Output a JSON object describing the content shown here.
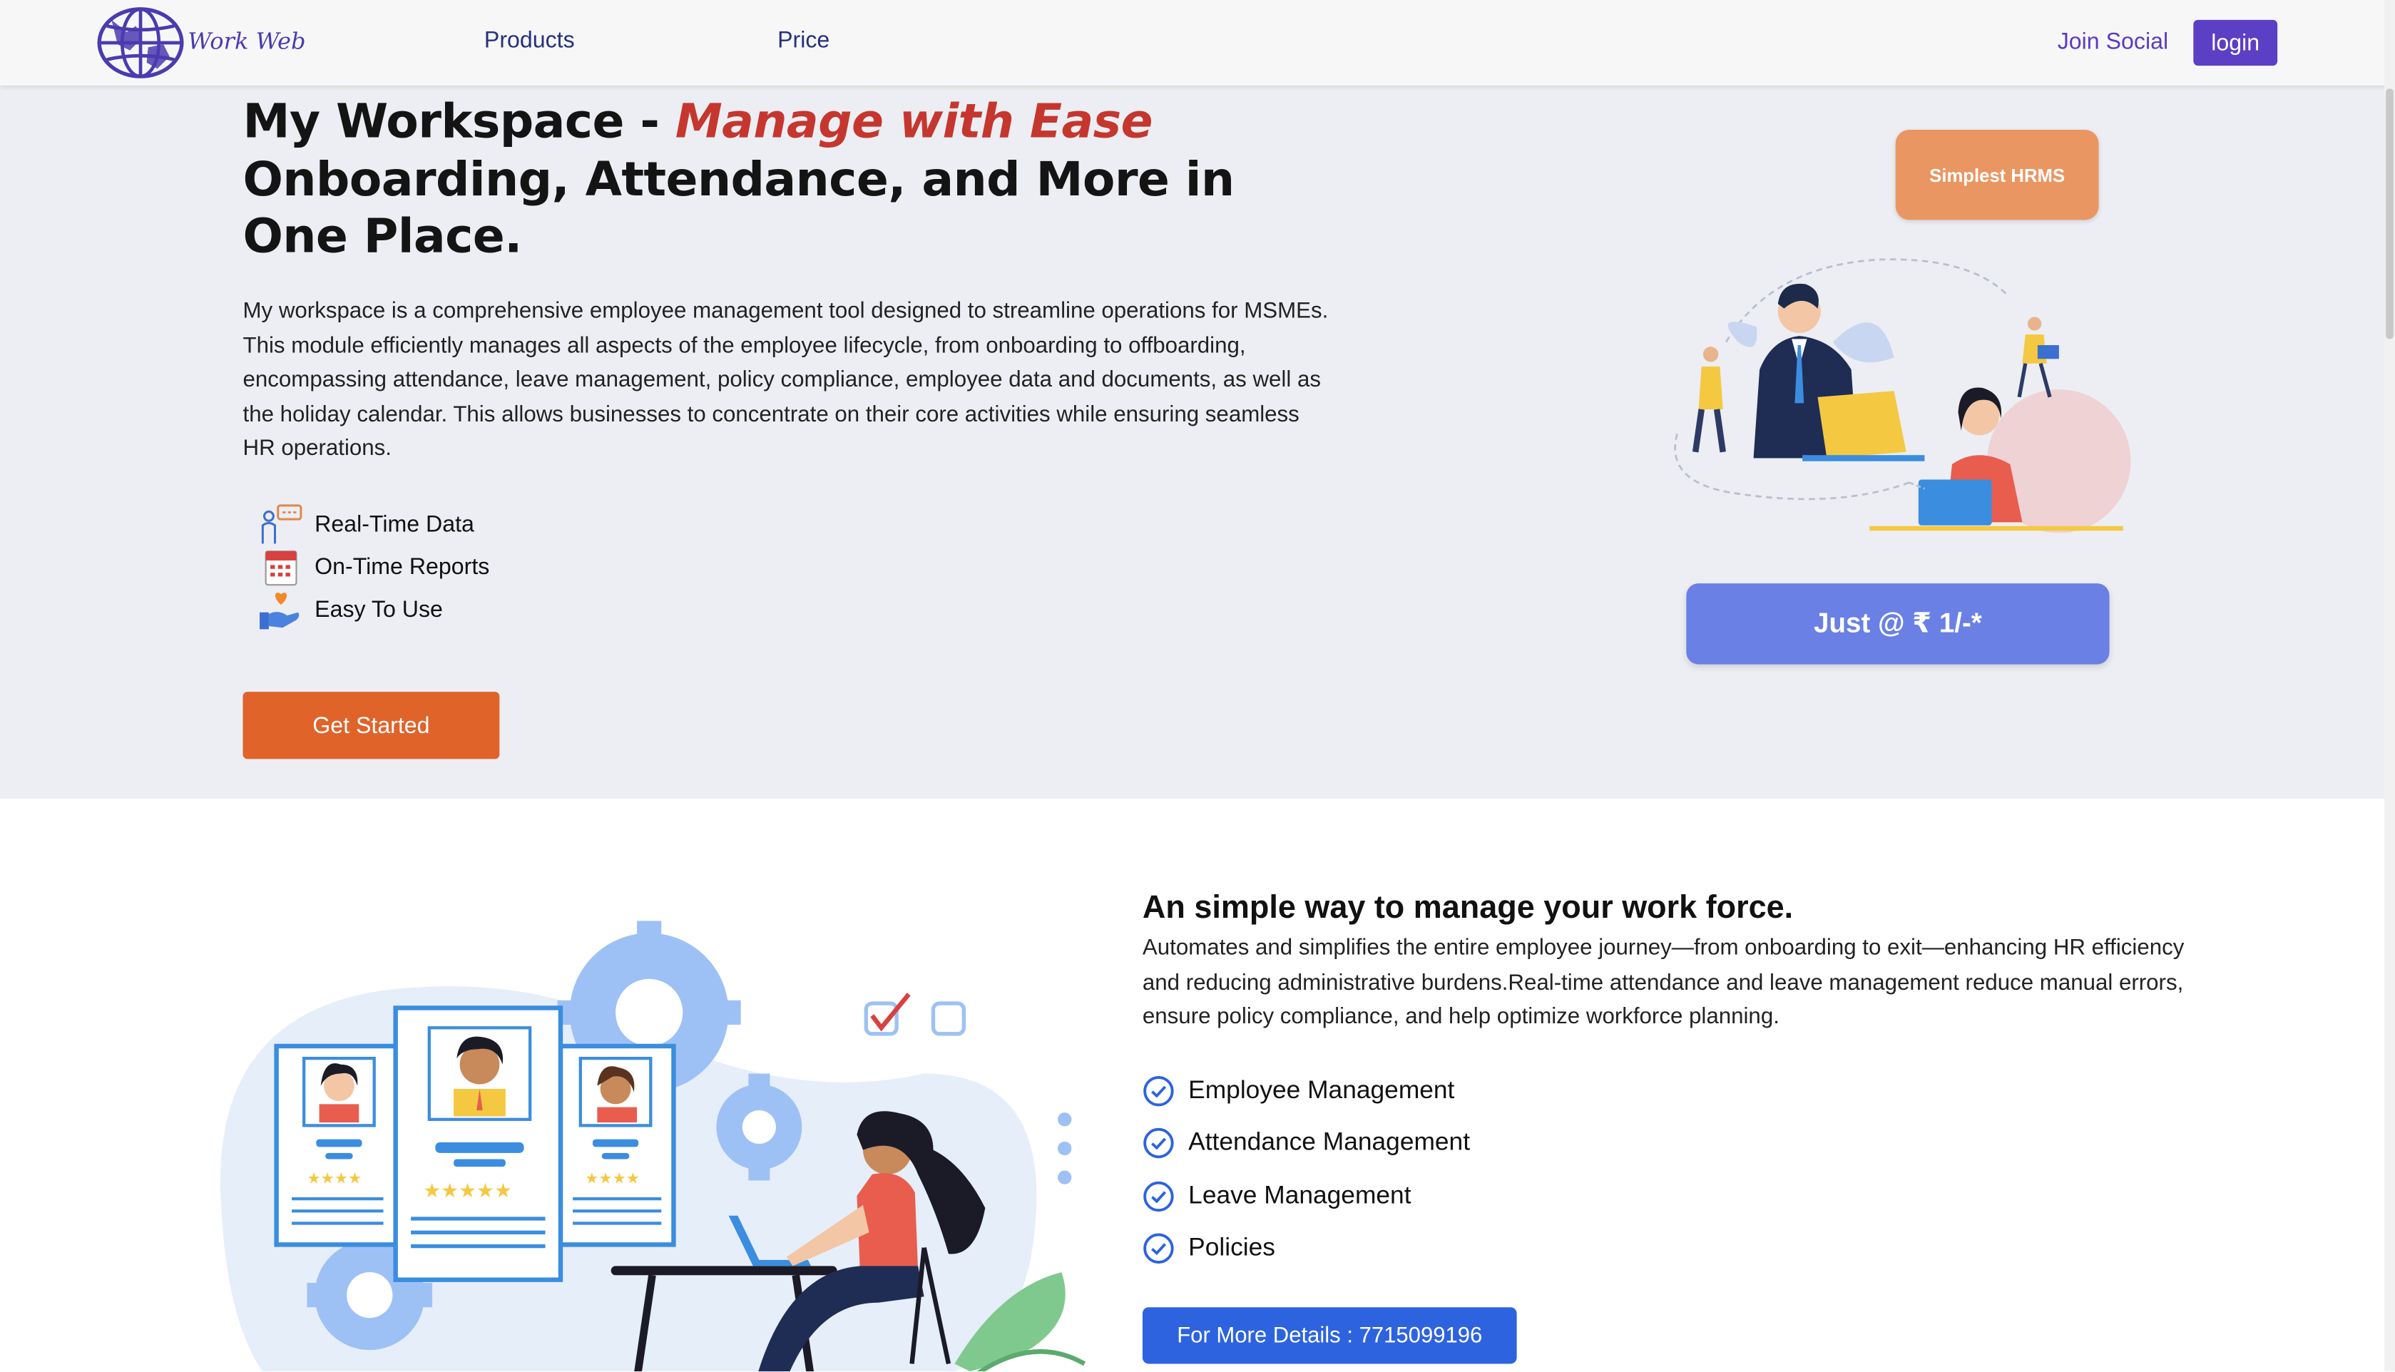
{
  "header": {
    "brand": "Work Web",
    "nav": [
      {
        "label": "Products"
      },
      {
        "label": "Price"
      }
    ],
    "join_label": "Join Social",
    "login_label": "login",
    "logo_icon": "globe-icon"
  },
  "hero": {
    "title_prefix": "My Workspace - ",
    "title_accent": "Manage with Ease",
    "title_rest": "Onboarding, Attendance, and More in One Place.",
    "description": "My workspace is a comprehensive employee management tool designed to streamline operations for MSMEs. This module efficiently manages all aspects of the employee lifecycle, from onboarding to offboarding, encompassing attendance, leave management, policy compliance, employee data and documents, as well as the holiday calendar. This allows businesses to concentrate on their core activities while ensuring seamless HR operations.",
    "features": [
      {
        "label": "Real-Time Data",
        "icon": "person-data-icon"
      },
      {
        "label": "On-Time Reports",
        "icon": "calendar-icon"
      },
      {
        "label": "Easy To Use",
        "icon": "hand-heart-icon"
      }
    ],
    "cta_label": "Get Started",
    "badge_label": "Simplest  HRMS",
    "price_label": "Just @ ₹ 1/-*",
    "accent_color": "#c5372e",
    "cta_color": "#e0632a"
  },
  "section2": {
    "title": "An simple way to manage your work force.",
    "description": "Automates and simplifies the entire employee journey—from onboarding to exit—enhancing HR efficiency and reducing administrative burdens.Real-time attendance and leave management reduce manual errors, ensure policy compliance, and help optimize workforce planning.",
    "items": [
      {
        "label": "Employee Management"
      },
      {
        "label": "Attendance Management"
      },
      {
        "label": "Leave Management"
      },
      {
        "label": "Policies"
      }
    ],
    "details_label": "For More Details : 7715099196",
    "details_color": "#2d63df"
  }
}
